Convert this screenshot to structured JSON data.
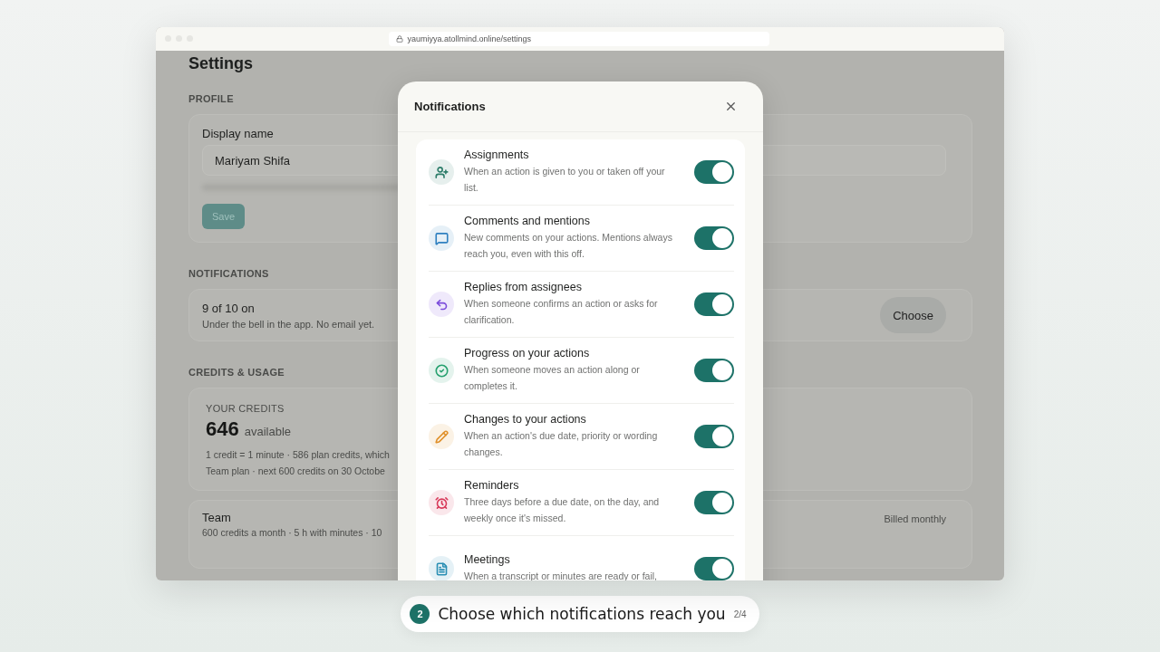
{
  "browser": {
    "url": "yaumiyya.atollmind.online/settings"
  },
  "settings": {
    "title": "Settings",
    "profile": {
      "heading": "PROFILE",
      "field_label": "Display name",
      "field_value": "Mariyam Shifa",
      "save_button": "Save"
    },
    "notifications": {
      "heading": "NOTIFICATIONS",
      "summary": "9 of 10 on",
      "description": "Under the bell in the app. No email yet.",
      "button": "Choose"
    },
    "credits": {
      "heading": "CREDITS & USAGE",
      "label": "YOUR CREDITS",
      "amount": "646",
      "unit": "available",
      "lines": [
        "1 credit = 1 minute · 586 plan credits, which",
        "Team plan · next 600 credits on 30 Octobe"
      ]
    },
    "plan": {
      "name": "Team",
      "details": "600 credits a month · 5 h with minutes · 10",
      "billing": "Billed monthly"
    }
  },
  "dialog": {
    "title": "Notifications",
    "items": [
      {
        "kind": "assign",
        "color": "#2e7d6a",
        "title": "Assignments",
        "description": "When an action is given to you or taken off your list.",
        "on": true
      },
      {
        "kind": "comment",
        "color": "#2f80c0",
        "title": "Comments and mentions",
        "description": "New comments on your actions. Mentions always reach you, even with this off.",
        "on": true
      },
      {
        "kind": "reply",
        "color": "#7c4ddb",
        "title": "Replies from assignees",
        "description": "When someone confirms an action or asks for clarification.",
        "on": true
      },
      {
        "kind": "progress",
        "color": "#25a06e",
        "title": "Progress on your actions",
        "description": "When someone moves an action along or completes it.",
        "on": true
      },
      {
        "kind": "edit",
        "color": "#e0902a",
        "title": "Changes to your actions",
        "description": "When an action's due date, priority or wording changes.",
        "on": true
      },
      {
        "kind": "alarm",
        "color": "#d83a5a",
        "title": "Reminders",
        "description": "Three days before a due date, on the day, and weekly once it's missed.",
        "on": true
      },
      {
        "kind": "document",
        "color": "#2a8fb4",
        "title": "Meetings",
        "description": "When a transcript or minutes are ready or fail,",
        "on": true
      }
    ]
  },
  "caption": {
    "step": "2",
    "text": "Choose which notifications reach you",
    "progress": "2/4"
  }
}
